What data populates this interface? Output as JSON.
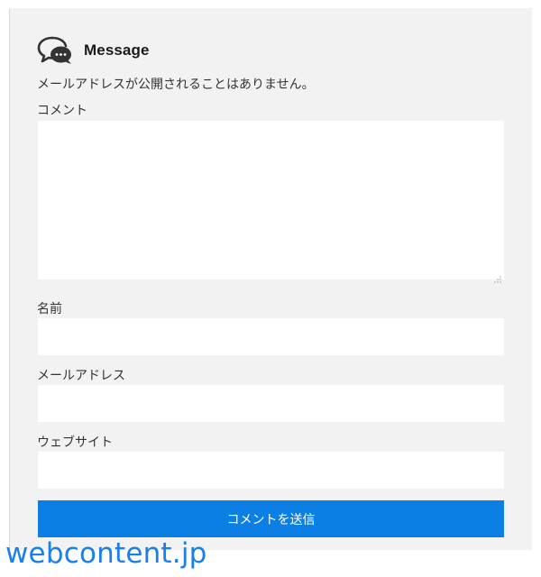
{
  "form": {
    "title": "Message",
    "notice": "メールアドレスが公開されることはありません。",
    "comment_label": "コメント",
    "comment_value": "",
    "name_label": "名前",
    "name_value": "",
    "email_label": "メールアドレス",
    "email_value": "",
    "website_label": "ウェブサイト",
    "website_value": "",
    "submit_label": "コメントを送信"
  },
  "watermark": "webcontent.jp",
  "icons": {
    "header": "chat-bubbles-icon",
    "textarea_grip": "resize-grip-icon"
  },
  "colors": {
    "card_background": "#f2f2f2",
    "field_background": "#ffffff",
    "submit_background": "#0b7fe3",
    "watermark": "#1a7fe8"
  }
}
